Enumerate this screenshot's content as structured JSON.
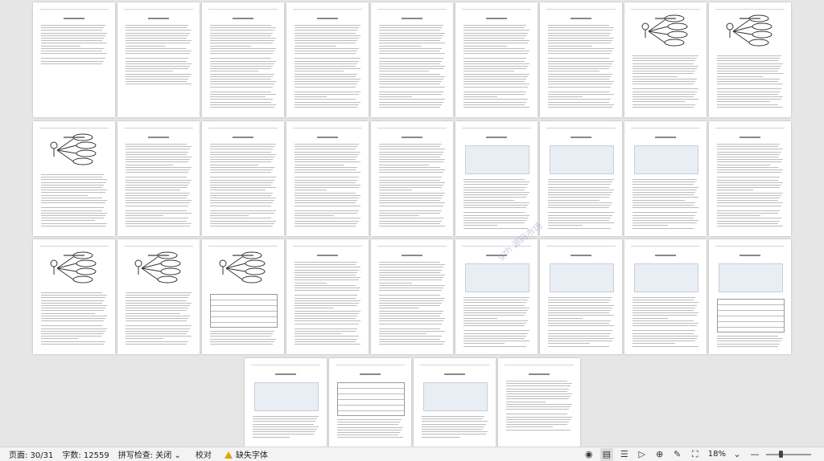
{
  "status_bar": {
    "page": "页面: 30/31",
    "word_count": "字数: 12559",
    "spell_check": "拼写检查: 关闭",
    "spell_dropdown_icon": "chevron-down-icon",
    "proofread": "校对",
    "missing_font": "缺失字体",
    "zoom": "18%",
    "icons": [
      "eye-icon",
      "page-view-icon",
      "list-view-icon",
      "play-icon",
      "globe-icon",
      "pen-icon",
      "fit-page-icon"
    ]
  },
  "watermark": "gzh 源码市场",
  "document": {
    "total_pages": 31,
    "current_page": 30
  }
}
